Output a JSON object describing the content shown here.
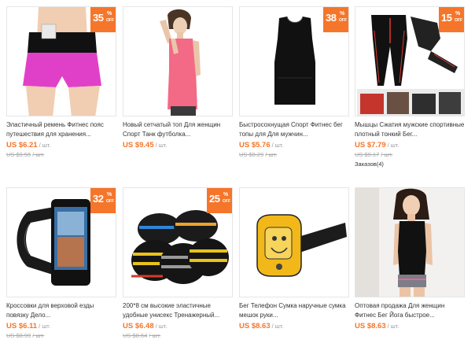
{
  "colors": {
    "accent": "#f5762a",
    "border": "#e6e6e6",
    "muted": "#999999",
    "text": "#333333"
  },
  "products": [
    {
      "title": "Эластичный ремень Фитнес пояс путешествия для хранения...",
      "price": "US $6.21",
      "unit": "/ шт.",
      "old_price": "US $9.55",
      "old_unit": "/ шт.",
      "discount": "35",
      "discount_symbol": "%",
      "discount_off": "OFF",
      "image": "running-belt-shorts"
    },
    {
      "title": "Новый сетчатый топ Для женщин Спорт Танк футболка...",
      "price": "US $9.45",
      "unit": "/ шт.",
      "image": "woman-pink-tank-top"
    },
    {
      "title": "Быстросохнущая Спорт Фитнес бег топы для Для мужчин...",
      "price": "US $5.76",
      "unit": "/ шт.",
      "old_price": "US $9.29",
      "old_unit": "/ шт.",
      "discount": "38",
      "discount_symbol": "%",
      "discount_off": "OFF",
      "image": "black-sleeveless-shirt"
    },
    {
      "title": "Мышцы Сжатия мужские спортивные плотный тонкий Бег...",
      "price": "US $7.79",
      "unit": "/ шт.",
      "old_price": "US $9.17",
      "old_unit": "/ шт.",
      "orders": "Заказов(4)",
      "discount": "15",
      "discount_symbol": "%",
      "discount_off": "OFF",
      "image": "compression-leggings"
    },
    {
      "title": "Кроссовки для верховой езды повязку Дело...",
      "price": "US $6.11",
      "unit": "/ шт.",
      "old_price": "US $8.99",
      "old_unit": "/ шт.",
      "discount": "32",
      "discount_symbol": "%",
      "discount_off": "OFF",
      "image": "phone-armband"
    },
    {
      "title": "200*8 см высокие эластичные удобные унисекс Тренажерный...",
      "price": "US $6.48",
      "unit": "/ шт.",
      "old_price": "US $8.64",
      "old_unit": "/ шт.",
      "discount": "25",
      "discount_symbol": "%",
      "discount_off": "OFF",
      "image": "elastic-straps"
    },
    {
      "title": "Бег Телефон Сумка наручные сумка мешок руки...",
      "price": "US $8.63",
      "unit": "/ шт.",
      "image": "yellow-phone-armband"
    },
    {
      "title": "Оптовая продажа Для женщин Фитнес Бег Йога быстрое...",
      "price": "US $8.63",
      "unit": "/ шт.",
      "image": "woman-black-yoga-top"
    }
  ]
}
